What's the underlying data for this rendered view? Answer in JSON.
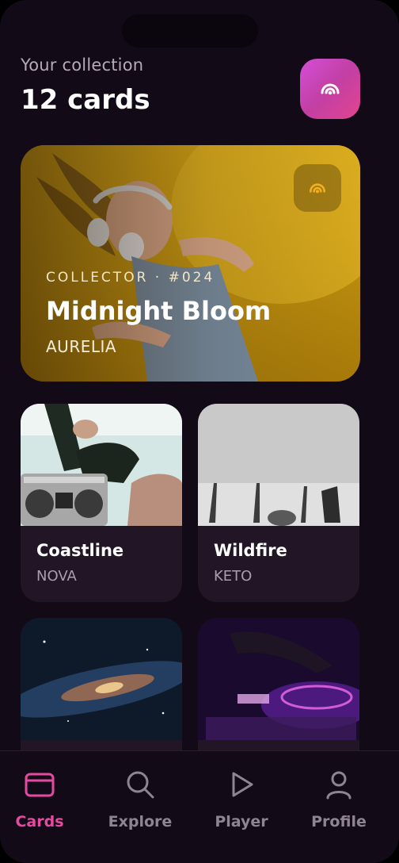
{
  "header": {
    "subtitle": "Your collection",
    "title": "12 cards",
    "action_icon": "nfc-signal-icon"
  },
  "featured": {
    "meta": "COLLECTOR · #024",
    "title": "Midnight Bloom",
    "artist": "AURELIA",
    "badge_icon": "nfc-signal-icon"
  },
  "cards": [
    {
      "name": "Coastline",
      "artist": "NOVA"
    },
    {
      "name": "Wildfire",
      "artist": "KETO"
    },
    {
      "name": "",
      "artist": ""
    },
    {
      "name": "",
      "artist": ""
    }
  ],
  "tabs": [
    {
      "label": "Cards",
      "icon": "card-icon",
      "active": true
    },
    {
      "label": "Explore",
      "icon": "search-icon",
      "active": false
    },
    {
      "label": "Player",
      "icon": "play-icon",
      "active": false
    },
    {
      "label": "Profile",
      "icon": "user-icon",
      "active": false
    }
  ],
  "colors": {
    "background": "#130a17",
    "accent": "#e54aa0",
    "featured_bg": "#d9a919"
  }
}
